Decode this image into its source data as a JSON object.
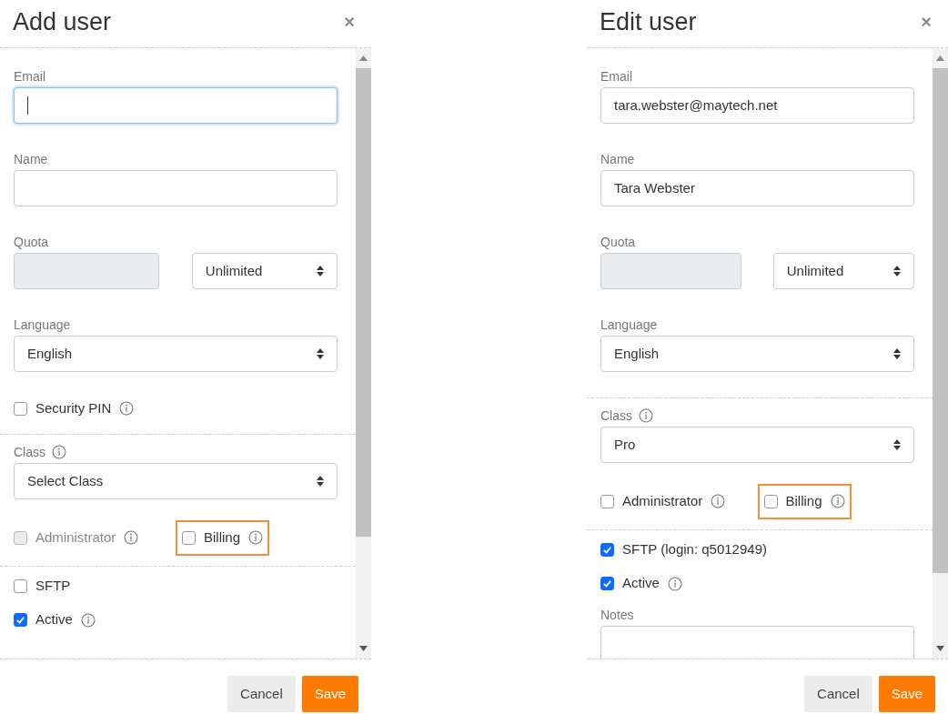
{
  "dialogs": [
    {
      "title": "Add user",
      "close": "×",
      "items": [
        {
          "kind": "field",
          "label": "Email",
          "focused": true
        },
        {
          "kind": "field",
          "label": "Name",
          "focused": false
        },
        {
          "kind": "quota",
          "label": "Quota",
          "value": "Unlimited"
        },
        {
          "kind": "select",
          "label": "Language",
          "value": "English",
          "info": false
        },
        {
          "kind": "checkbox",
          "label": "Security PIN",
          "checked": false,
          "info": true
        },
        {
          "kind": "divider"
        },
        {
          "kind": "select",
          "label": "Class",
          "value": "Select Class",
          "info": true
        },
        {
          "kind": "pair",
          "options": [
            {
              "label": "Administrator",
              "checked": false,
              "disabled": true,
              "highlighted": false,
              "info": true
            },
            {
              "label": "Billing",
              "checked": false,
              "disabled": false,
              "highlighted": true,
              "info": true
            }
          ]
        },
        {
          "kind": "divider"
        },
        {
          "kind": "checkbox",
          "label": "SFTP",
          "checked": false,
          "info": false
        },
        {
          "kind": "checkbox",
          "label": "Active",
          "checked": true,
          "info": true
        }
      ],
      "buttons": [
        {
          "label": "Cancel",
          "kind": "secondary"
        },
        {
          "label": "Save",
          "kind": "primary"
        }
      ]
    },
    {
      "title": "Edit user",
      "close": "×",
      "items": [
        {
          "kind": "field",
          "label": "Email",
          "value": "tara.webster@maytech.net",
          "focused": false
        },
        {
          "kind": "field",
          "label": "Name",
          "value": "Tara Webster",
          "focused": false
        },
        {
          "kind": "quota",
          "label": "Quota",
          "value": "Unlimited"
        },
        {
          "kind": "select",
          "label": "Language",
          "value": "English",
          "info": false
        },
        {
          "kind": "divider"
        },
        {
          "kind": "select",
          "label": "Class",
          "value": "Pro",
          "info": true
        },
        {
          "kind": "pair",
          "options": [
            {
              "label": "Administrator",
              "checked": false,
              "disabled": false,
              "highlighted": false,
              "info": true
            },
            {
              "label": "Billing",
              "checked": false,
              "disabled": false,
              "highlighted": true,
              "info": true
            }
          ]
        },
        {
          "kind": "divider"
        },
        {
          "kind": "checkbox",
          "label": "SFTP (login: q5012949)",
          "checked": true,
          "info": false
        },
        {
          "kind": "checkbox",
          "label": "Active",
          "checked": true,
          "info": true
        },
        {
          "kind": "textarea",
          "label": "Notes"
        }
      ],
      "buttons": [
        {
          "label": "Cancel",
          "kind": "secondary"
        },
        {
          "label": "Save",
          "kind": "primary"
        }
      ]
    }
  ]
}
